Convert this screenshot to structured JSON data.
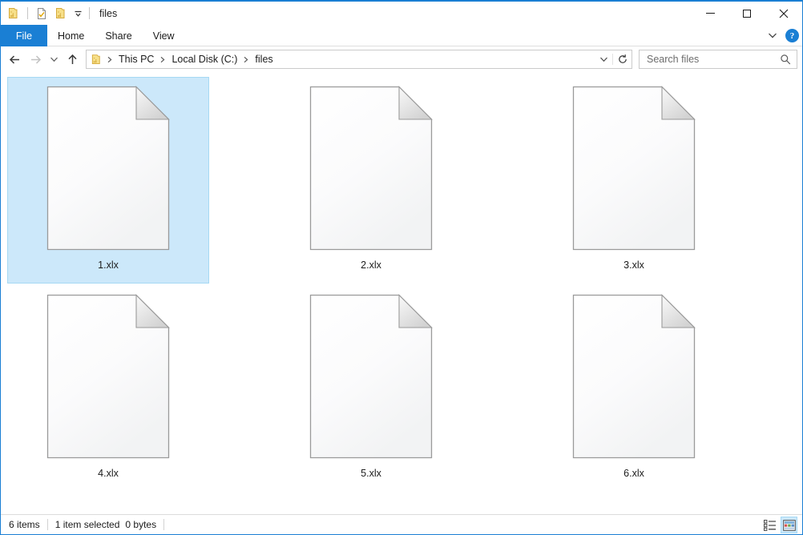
{
  "window": {
    "title": "files",
    "accent_color": "#1a7fd4",
    "selection_fill": "#cce8fa",
    "selection_border": "#a6d9f4"
  },
  "titlebar": {
    "quick_access": [
      {
        "name": "folder-icon",
        "label": "Quick access toolbar folder"
      },
      {
        "name": "properties-icon",
        "label": "Properties"
      },
      {
        "name": "new-folder-icon",
        "label": "New folder"
      },
      {
        "name": "chevron-down-icon",
        "label": "Customize Quick Access Toolbar"
      }
    ],
    "controls": {
      "minimize": "Minimize",
      "maximize": "Maximize",
      "close": "Close"
    }
  },
  "ribbon": {
    "tabs": [
      {
        "label": "File",
        "active": true
      },
      {
        "label": "Home",
        "active": false
      },
      {
        "label": "Share",
        "active": false
      },
      {
        "label": "View",
        "active": false
      }
    ],
    "expand_label": "Expand the Ribbon",
    "help_label": "?"
  },
  "nav": {
    "back_label": "Back",
    "forward_label": "Forward",
    "recent_label": "Recent locations",
    "up_label": "Up",
    "breadcrumbs": [
      {
        "label": "This PC"
      },
      {
        "label": "Local Disk (C:)"
      },
      {
        "label": "files"
      }
    ],
    "address_dropdown_label": "Previous locations",
    "refresh_label": "Refresh"
  },
  "search": {
    "placeholder": "Search files",
    "value": "",
    "icon": "search-icon"
  },
  "files": [
    {
      "name": "1.xlx",
      "selected": true
    },
    {
      "name": "2.xlx",
      "selected": false
    },
    {
      "name": "3.xlx",
      "selected": false
    },
    {
      "name": "4.xlx",
      "selected": false
    },
    {
      "name": "5.xlx",
      "selected": false
    },
    {
      "name": "6.xlx",
      "selected": false
    }
  ],
  "status": {
    "item_count": "6 items",
    "selection": "1 item selected",
    "size": "0 bytes",
    "views": [
      {
        "name": "details-view-icon",
        "label": "Details view",
        "active": false
      },
      {
        "name": "large-icons-view-icon",
        "label": "Large icons view",
        "active": true
      }
    ]
  }
}
